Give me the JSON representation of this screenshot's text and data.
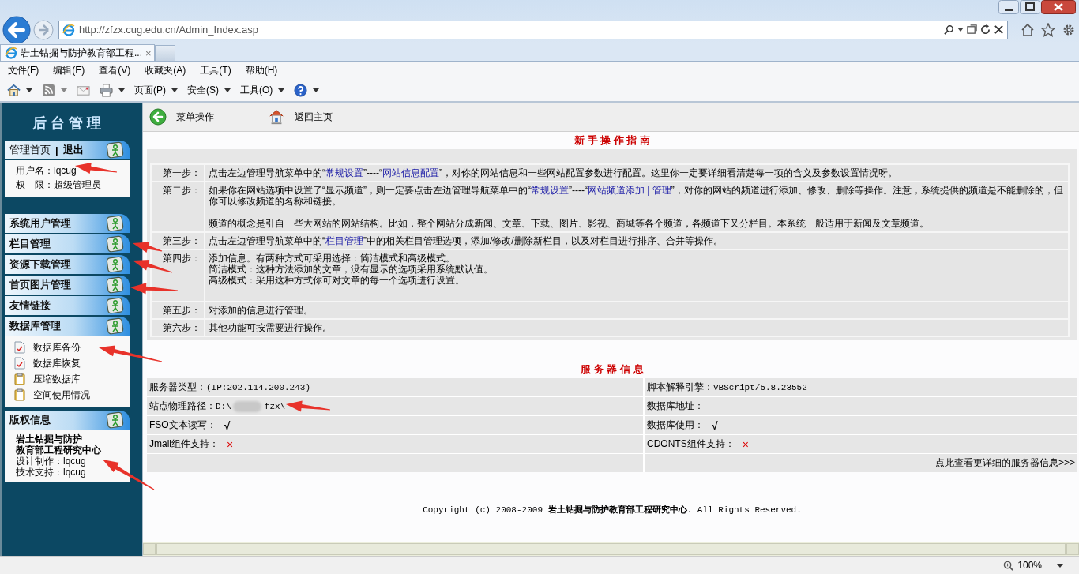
{
  "browser": {
    "address": "http://zfzx.cug.edu.cn/Admin_Index.asp",
    "tab": {
      "title": "岩土钻掘与防护教育部工程...",
      "close": "×"
    },
    "menu": [
      "文件(F)",
      "编辑(E)",
      "查看(V)",
      "收藏夹(A)",
      "工具(T)",
      "帮助(H)"
    ],
    "commands": [
      {
        "kind": "home",
        "dropdown": true
      },
      {
        "kind": "feed",
        "dropdown": true
      },
      {
        "kind": "mail",
        "dropdown": false
      },
      {
        "kind": "print",
        "dropdown": true
      },
      {
        "kind": "text",
        "label": "页面(P)",
        "dropdown": true
      },
      {
        "kind": "text",
        "label": "安全(S)",
        "dropdown": true
      },
      {
        "kind": "text",
        "label": "工具(O)",
        "dropdown": true
      },
      {
        "kind": "help",
        "dropdown": true
      }
    ],
    "zoom": "100%"
  },
  "sidebar": {
    "title": "后 台 管 理",
    "account": {
      "home": "管理首页",
      "separator": "|",
      "logout": "退出",
      "lines": [
        "用户名：lqcug",
        "权　限：超级管理员"
      ]
    },
    "sections": [
      {
        "title": "系统用户管理"
      },
      {
        "title": "栏目管理"
      },
      {
        "title": "资源下载管理"
      },
      {
        "title": "首页图片管理"
      },
      {
        "title": "友情链接"
      },
      {
        "title": "数据库管理",
        "items": [
          {
            "label": "数据库备份",
            "kind": "doc"
          },
          {
            "label": "数据库恢复",
            "kind": "doc"
          },
          {
            "label": "压缩数据库",
            "kind": "clipboard"
          },
          {
            "label": "空间使用情况",
            "kind": "clipboard"
          }
        ]
      }
    ],
    "about": {
      "title": "版权信息",
      "org": [
        "岩土钻掘与防护",
        "教育部工程研究中心"
      ],
      "credits": [
        "设计制作：lqcug",
        "技术支持：lqcug"
      ]
    }
  },
  "toolbar": [
    {
      "kind": "back",
      "label": "菜单操作"
    },
    {
      "kind": "home",
      "label": "返回主页"
    }
  ],
  "guide": {
    "title": "新 手 操 作 指 南",
    "steps": [
      {
        "label": "第一步：",
        "paragraphs": [
          [
            [
              {
                "kind": "text",
                "text": "点击左边管理导航菜单中的“"
              },
              {
                "kind": "link",
                "text": "常规设置"
              },
              {
                "kind": "text",
                "text": "”----“"
              },
              {
                "kind": "link",
                "text": "网站信息配置"
              },
              {
                "kind": "text",
                "text": "”，对你的网站信息和一些网站配置参数进行配置。这里你一定要详细看清楚每一项的含义及参数设置情况呀。"
              }
            ]
          ]
        ]
      },
      {
        "label": "第二步：",
        "paragraphs": [
          [
            [
              {
                "kind": "text",
                "text": "如果你在网站选项中设置了“显示频道”，则一定要点击左边管理导航菜单中的“"
              },
              {
                "kind": "link",
                "text": "常规设置"
              },
              {
                "kind": "text",
                "text": "”----“"
              },
              {
                "kind": "link",
                "text": "网站频道添加 | 管理"
              },
              {
                "kind": "text",
                "text": "”，对你的网站的频道进行添加、修改、删除等操作。注意，系统提供的频道是不能删除的，但你可以修改频道的名称和链接。"
              }
            ]
          ],
          [
            [
              {
                "kind": "text",
                "text": "频道的概念是引自一些大网站的网站结构。比如，整个网站分成新闻、文章、下载、图片、影视、商城等各个频道，各频道下又分栏目。本系统一般适用于新闻及文章频道。"
              }
            ]
          ]
        ]
      },
      {
        "label": "第三步：",
        "paragraphs": [
          [
            [
              {
                "kind": "text",
                "text": "点击左边管理导航菜单中的“"
              },
              {
                "kind": "link",
                "text": "栏目管理"
              },
              {
                "kind": "text",
                "text": "”中的相关栏目管理选项，添加/修改/删除新栏目，以及对栏目进行排序、合并等操作。"
              }
            ]
          ]
        ]
      },
      {
        "label": "第四步：",
        "paragraphs": [
          [
            [
              {
                "kind": "text",
                "text": "添加信息。有两种方式可采用选择：简洁模式和高级模式。"
              }
            ],
            [
              {
                "kind": "text",
                "text": "简洁模式：这种方法添加的文章，没有显示的选项采用系统默认值。"
              }
            ],
            [
              {
                "kind": "text",
                "text": "高级模式：采用这种方式你可对文章的每一个选项进行设置。"
              }
            ]
          ]
        ]
      },
      {
        "label": "第五步：",
        "paragraphs": [
          [
            [
              {
                "kind": "text",
                "text": "对添加的信息进行管理。"
              }
            ]
          ]
        ]
      },
      {
        "label": "第六步：",
        "paragraphs": [
          [
            [
              {
                "kind": "text",
                "text": "其他功能可按需要进行操作。"
              }
            ]
          ]
        ]
      }
    ]
  },
  "server": {
    "title": "服 务 器 信 息",
    "rows": [
      [
        {
          "kind": "value",
          "label": "服务器类型：",
          "value": "(IP:202.114.200.243)"
        },
        {
          "kind": "value",
          "label": "脚本解释引擎：",
          "value": "VBScript/5.8.23552"
        }
      ],
      [
        {
          "kind": "path",
          "label": "站点物理路径：",
          "value": "D:\\",
          "redacted": true,
          "value_after": "fzx\\"
        },
        {
          "kind": "value",
          "label": "数据库地址："
        }
      ],
      [
        {
          "kind": "status",
          "label": "FSO文本读写：",
          "mark": "√",
          "ok": true
        },
        {
          "kind": "status",
          "label": "数据库使用：",
          "mark": "√",
          "ok": true
        }
      ],
      [
        {
          "kind": "status",
          "label": "Jmail组件支持：",
          "mark": "×",
          "ok": false
        },
        {
          "kind": "status",
          "label": "CDONTS组件支持：",
          "mark": "×",
          "ok": false
        }
      ],
      [
        {
          "kind": "empty"
        },
        {
          "kind": "link",
          "text": "点此查看更详细的服务器信息>>>"
        }
      ]
    ]
  },
  "copyright": "Copyright (c) 2008-2009 **岩土钻掘与防护教育部工程研究中心**. All Rights Reserved."
}
